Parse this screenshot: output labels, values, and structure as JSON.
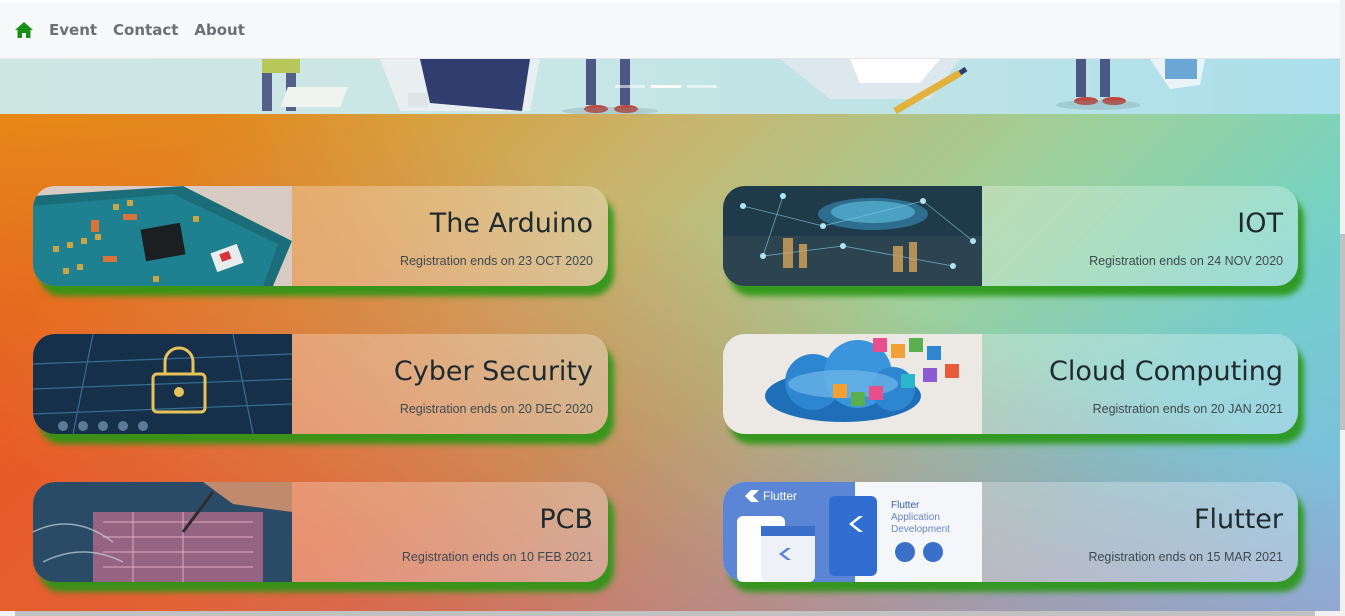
{
  "nav": {
    "home_icon": "home-icon",
    "links": [
      "Event",
      "Contact",
      "About"
    ]
  },
  "carousel": {
    "slide_count": 3,
    "active_index": 1
  },
  "events": [
    {
      "title": "The Arduino",
      "subtitle": "Registration ends on 23 OCT 2020",
      "image": "arduino-board-image"
    },
    {
      "title": "IOT",
      "subtitle": "Registration ends on 24 NOV 2020",
      "image": "iot-city-image"
    },
    {
      "title": "Cyber Security",
      "subtitle": "Registration ends on 20 DEC 2020",
      "image": "cyber-lock-image"
    },
    {
      "title": "Cloud Computing",
      "subtitle": "Registration ends on 20 JAN 2021",
      "image": "cloud-apps-image"
    },
    {
      "title": "PCB",
      "subtitle": "Registration ends on 10 FEB 2021",
      "image": "pcb-soldering-image"
    },
    {
      "title": "Flutter",
      "subtitle": "Registration ends on 15 MAR 2021",
      "image": "flutter-app-image"
    }
  ],
  "flutter_image_text": {
    "brand": "Flutter",
    "caption_line1": "Flutter",
    "caption_line2": "Application",
    "caption_line3": "Development"
  },
  "colors": {
    "nav_home": "#188f18",
    "card_shadow": "#2aa020"
  }
}
